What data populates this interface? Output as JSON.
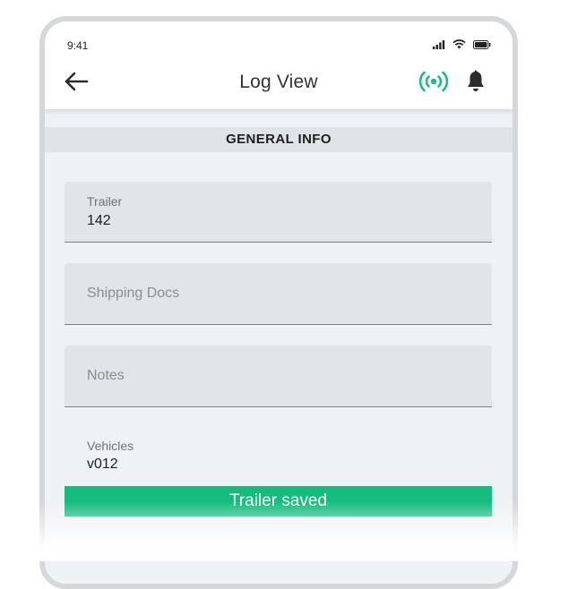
{
  "status_bar": {
    "time": "9:41"
  },
  "app_bar": {
    "title": "Log View"
  },
  "section": {
    "title": "GENERAL INFO"
  },
  "fields": {
    "trailer": {
      "label": "Trailer",
      "value": "142"
    },
    "shipping_docs": {
      "placeholder": "Shipping Docs"
    },
    "notes": {
      "placeholder": "Notes"
    },
    "vehicles": {
      "label": "Vehicles",
      "value": "v012"
    }
  },
  "toast": {
    "message": "Trailer saved"
  },
  "colors": {
    "accent": "#16bb80",
    "signal_icon": "#1dbb7f",
    "section_bg": "#e0e3e7",
    "content_bg": "#eef1f5"
  },
  "icons": {
    "back": "arrow-left-icon",
    "signal": "broadcast-signal-icon",
    "notifications": "bell-icon",
    "cellular": "cellular-signal-icon",
    "wifi": "wifi-icon",
    "battery": "battery-icon"
  }
}
